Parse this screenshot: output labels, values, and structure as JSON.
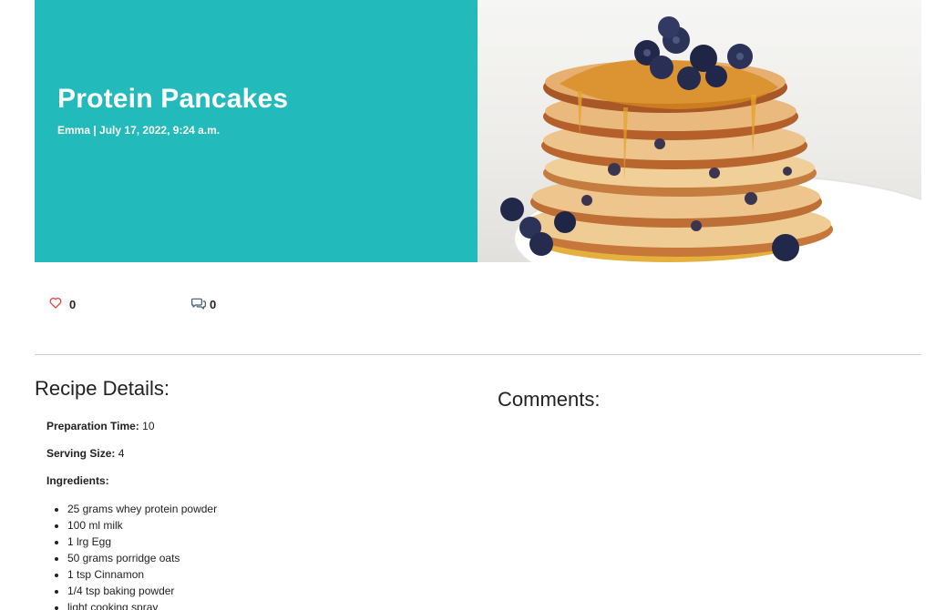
{
  "recipe": {
    "title": "Protein Pancakes",
    "meta": "Emma | July 17, 2022, 9:24 a.m."
  },
  "stats": {
    "likes": "0",
    "comments": "0"
  },
  "details": {
    "heading": "Recipe Details:",
    "prep_label": "Preparation Time:",
    "prep_value": "10",
    "serving_label": "Serving Size:",
    "serving_value": "4",
    "ingredients_label": "Ingredients:",
    "ingredients": [
      "25 grams whey protein powder",
      "100 ml milk",
      "1 lrg Egg",
      "50 grams porridge oats",
      "1 tsp Cinnamon",
      "1/4 tsp baking powder",
      "light cooking spray"
    ]
  },
  "comments": {
    "heading": "Comments:"
  },
  "icons": {
    "like": "heart-outline-icon",
    "comments": "speech-bubbles-icon"
  },
  "colors": {
    "hero_background": "#22babb",
    "like_icon": "#e0403a",
    "comment_icon": "#3e5a74"
  }
}
